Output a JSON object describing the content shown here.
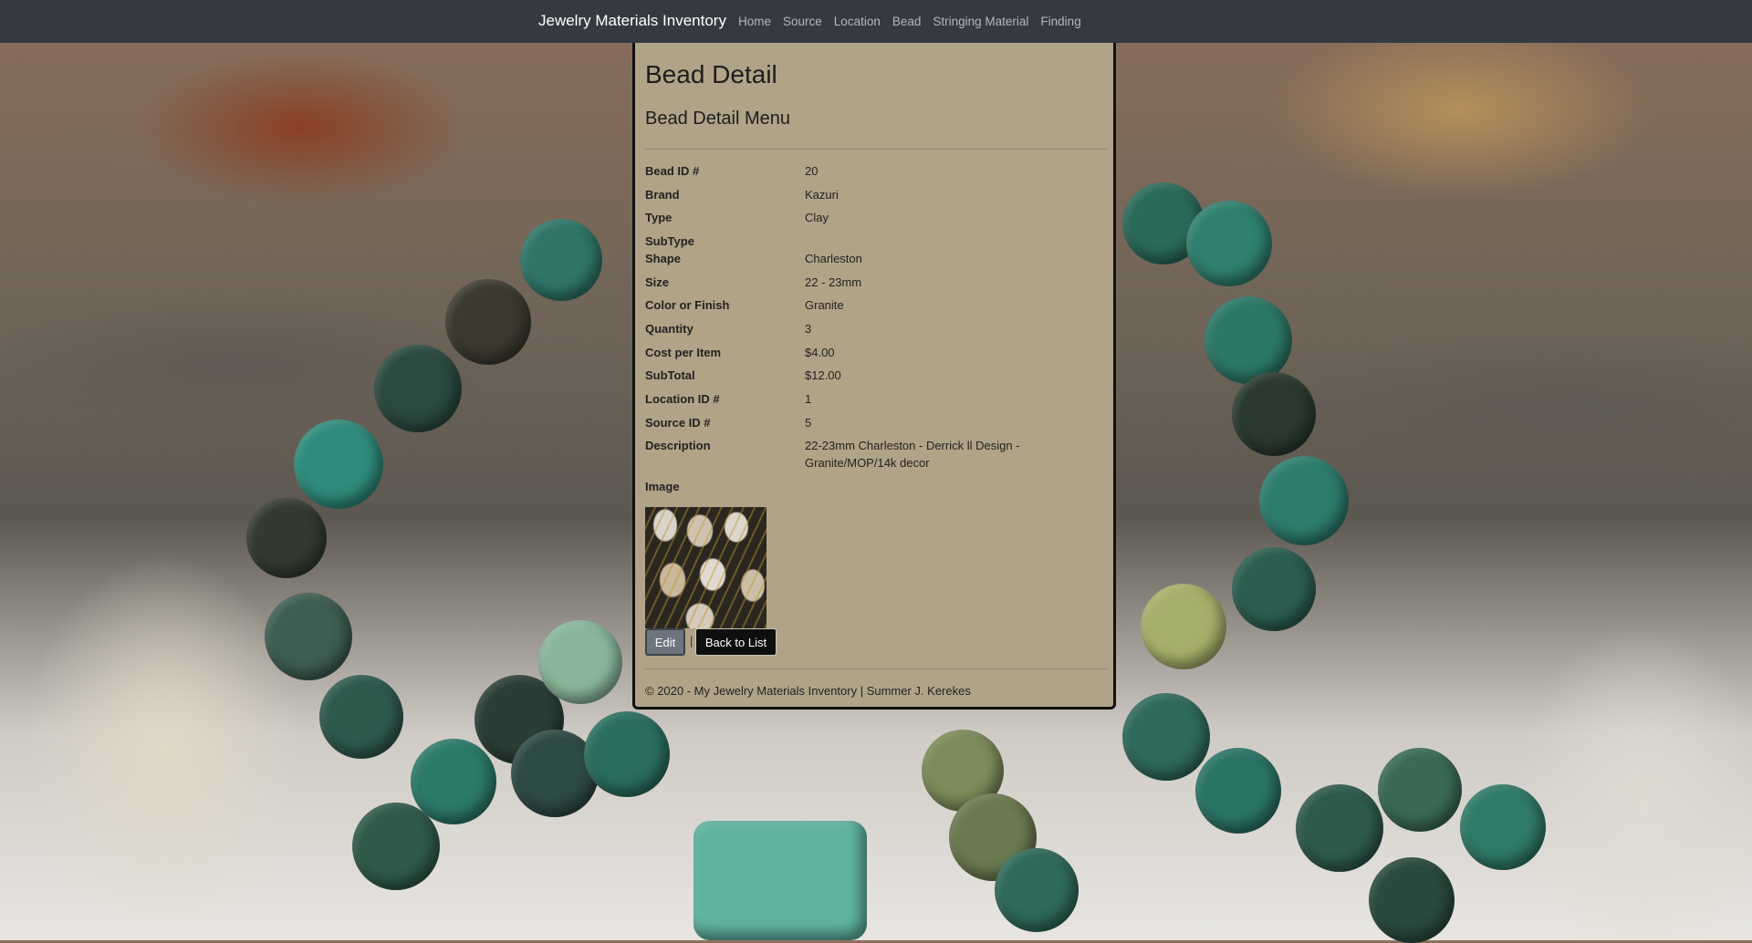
{
  "navbar": {
    "brand": "Jewelry Materials Inventory",
    "links": [
      "Home",
      "Source",
      "Location",
      "Bead",
      "Stringing Material",
      "Finding"
    ]
  },
  "page": {
    "title": "Bead Detail",
    "subtitle": "Bead Detail Menu"
  },
  "details": [
    {
      "label": "Bead ID #",
      "value": "20"
    },
    {
      "label": "Brand",
      "value": "Kazuri"
    },
    {
      "label": "Type",
      "value": "Clay"
    },
    {
      "label": "SubType",
      "value": ""
    },
    {
      "label": "Shape",
      "value": "Charleston"
    },
    {
      "label": "Size",
      "value": "22 - 23mm"
    },
    {
      "label": "Color or Finish",
      "value": "Granite"
    },
    {
      "label": "Quantity",
      "value": "3"
    },
    {
      "label": "Cost per Item",
      "value": "$4.00"
    },
    {
      "label": "SubTotal",
      "value": "$12.00"
    },
    {
      "label": "Location ID #",
      "value": "1"
    },
    {
      "label": "Source ID #",
      "value": "5"
    },
    {
      "label": "Description",
      "value": "22-23mm Charleston - Derrick ll Design - Granite/MOP/14k decor"
    },
    {
      "label": "Image",
      "value": ""
    }
  ],
  "actions": {
    "edit_label": "Edit",
    "separator": "|",
    "back_label": "Back to List"
  },
  "footer": {
    "text": "© 2020 - My Jewelry Materials Inventory | Summer J. Kerekes"
  },
  "colors": {
    "navbar": "#343a40",
    "card": "#b1a387",
    "edit_button": "#6c757d",
    "back_button": "#0f0f10"
  }
}
